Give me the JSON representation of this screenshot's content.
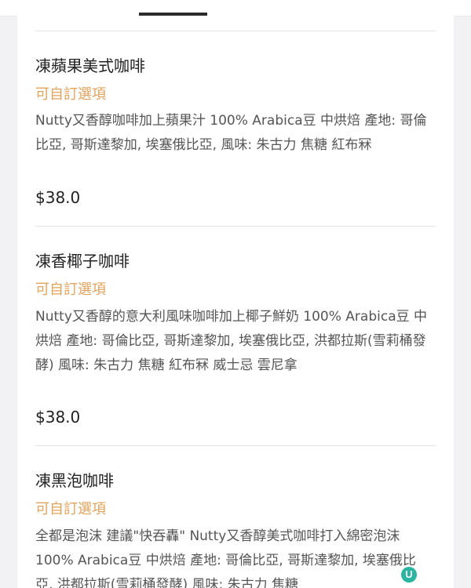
{
  "menu_items": [
    {
      "name": "凍蘋果美式咖啡",
      "option": "可自訂選項",
      "description": "Nutty又香醇咖啡加上蘋果汁  100% Arabica豆 中烘焙 產地: 哥倫比亞, 哥斯達黎加, 埃塞俄比亞, 風味: 朱古力 焦糖 紅布冧",
      "price": "$38.0"
    },
    {
      "name": "凍香椰子咖啡",
      "option": "可自訂選項",
      "description": " Nutty又香醇的意大利風味咖啡加上椰子鮮奶 100% Arabica豆 中烘焙 產地: 哥倫比亞, 哥斯達黎加, 埃塞俄比亞, 洪都拉斯(雪莉桶發酵) 風味: 朱古力 焦糖 紅布冧 威士忌 雲尼拿",
      "price": "$38.0"
    },
    {
      "name": "凍黑泡咖啡",
      "option": "可自訂選項",
      "description": "全都是泡沫 建議\"快吞轟\" Nutty又香醇美式咖啡打入綿密泡沫  100% Arabica豆 中烘焙 產地: 哥倫比亞, 哥斯達黎加, 埃塞俄比亞, 洪都拉斯(雪莉桶發酵) 風味: 朱古力 焦糖",
      "price": ""
    }
  ],
  "badge": {
    "icon": "u-logo-icon",
    "letter": "U",
    "color": "#2ab5a0"
  },
  "colors": {
    "option_accent": "#e3a35b",
    "text_primary": "#222222",
    "text_secondary": "#555555"
  }
}
